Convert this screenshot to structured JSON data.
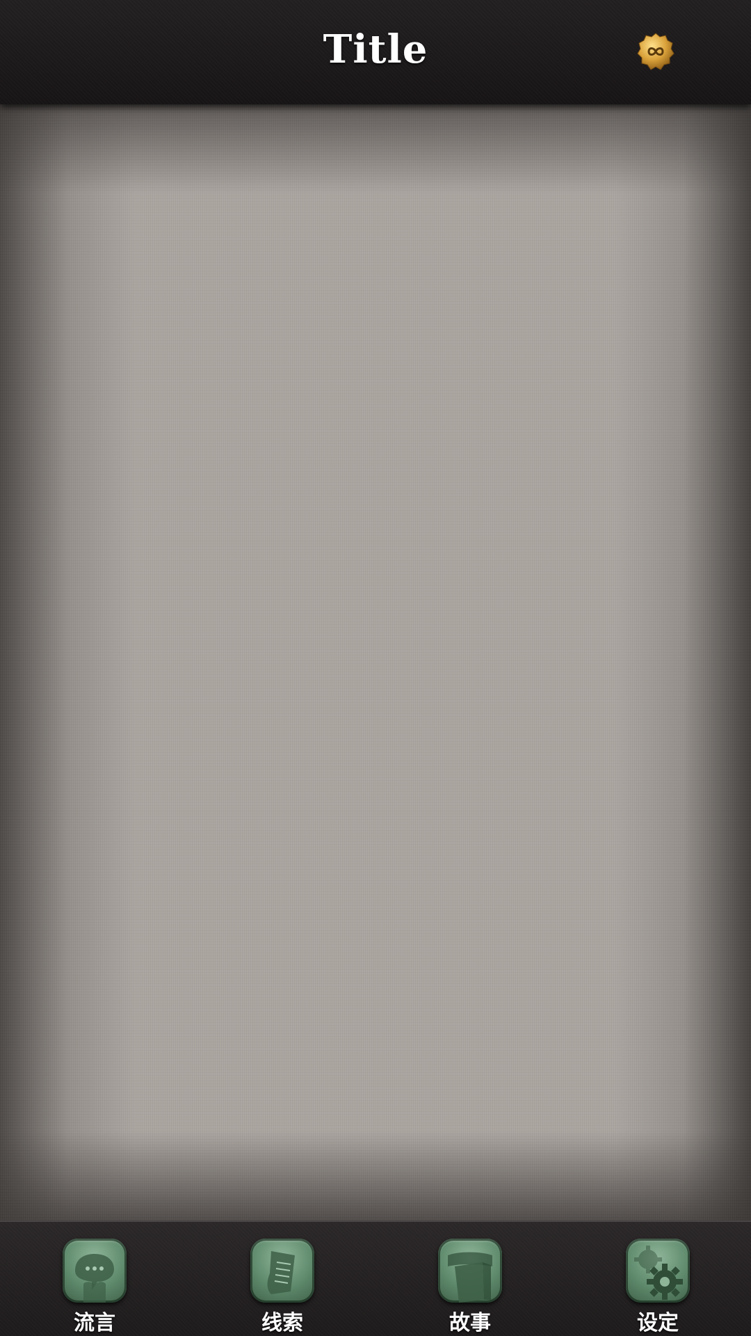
{
  "header": {
    "title": "Title",
    "badge_icon": "infinity-icon"
  },
  "tabs": [
    {
      "label": "流言",
      "icon": "chat-bubble-icon"
    },
    {
      "label": "线索",
      "icon": "document-icon"
    },
    {
      "label": "故事",
      "icon": "book-icon"
    },
    {
      "label": "设定",
      "icon": "gear-icon"
    }
  ],
  "colors": {
    "bar_background": "#1c191a",
    "canvas": "#aaa49f",
    "tab_icon_green": "#5f8a6c",
    "badge_gold": "#d9a13a",
    "text": "#ffffff"
  }
}
